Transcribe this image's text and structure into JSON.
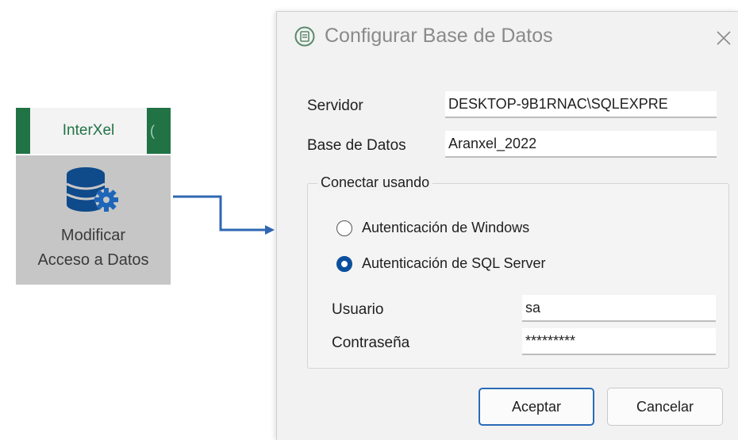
{
  "ribbon": {
    "tab_label": "InterXel",
    "next_tab_fragment": "(",
    "button_label_line1": "Modificar",
    "button_label_line2": "Acceso a Datos",
    "button_icon": "database-gear-icon"
  },
  "dialog": {
    "title": "Configurar Base de Datos",
    "title_icon": "app-icon",
    "close_icon": "close-icon",
    "servidor_label": "Servidor",
    "servidor_value": "DESKTOP-9B1RNAC\\SQLEXPRE",
    "base_label": "Base de Datos",
    "base_value": "Aranxel_2022",
    "group_title": "Conectar usando",
    "radio_windows": "Autenticación de Windows",
    "radio_sql": "Autenticación de SQL Server",
    "selected_auth": "sql",
    "usuario_label": "Usuario",
    "usuario_value": "sa",
    "password_label": "Contraseña",
    "password_value": "*********",
    "ok_button": "Aceptar",
    "cancel_button": "Cancelar"
  },
  "colors": {
    "excel_green": "#217346",
    "accent_blue": "#0a4f9e",
    "arrow_blue": "#2f67b2"
  }
}
